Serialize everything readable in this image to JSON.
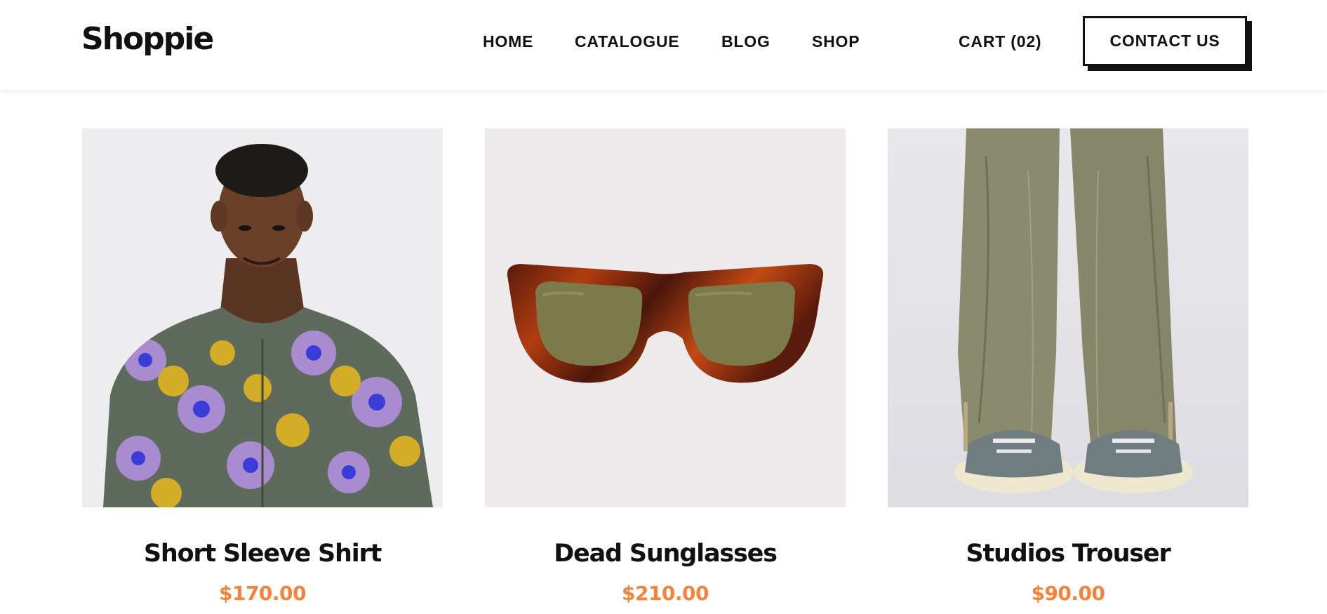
{
  "brand": {
    "logo_text": "Shoppie"
  },
  "nav": {
    "items": [
      {
        "label": "HOME"
      },
      {
        "label": "CATALOGUE"
      },
      {
        "label": "BLOG"
      },
      {
        "label": "SHOP"
      }
    ],
    "cart_label": "CART (02)",
    "contact_label": "CONTACT US"
  },
  "colors": {
    "text": "#111111",
    "price": "#f4823a",
    "image_bg_shirt": "#ededf0",
    "image_bg_sunglasses": "#eceaea",
    "image_bg_trouser": "#e6e6ea"
  },
  "products": [
    {
      "title": "Short Sleeve Shirt",
      "price": "$170.00",
      "image": "floral-shirt-model"
    },
    {
      "title": "Dead Sunglasses",
      "price": "$210.00",
      "image": "tortoise-sunglasses"
    },
    {
      "title": "Studios Trouser",
      "price": "$90.00",
      "image": "olive-trousers"
    }
  ]
}
